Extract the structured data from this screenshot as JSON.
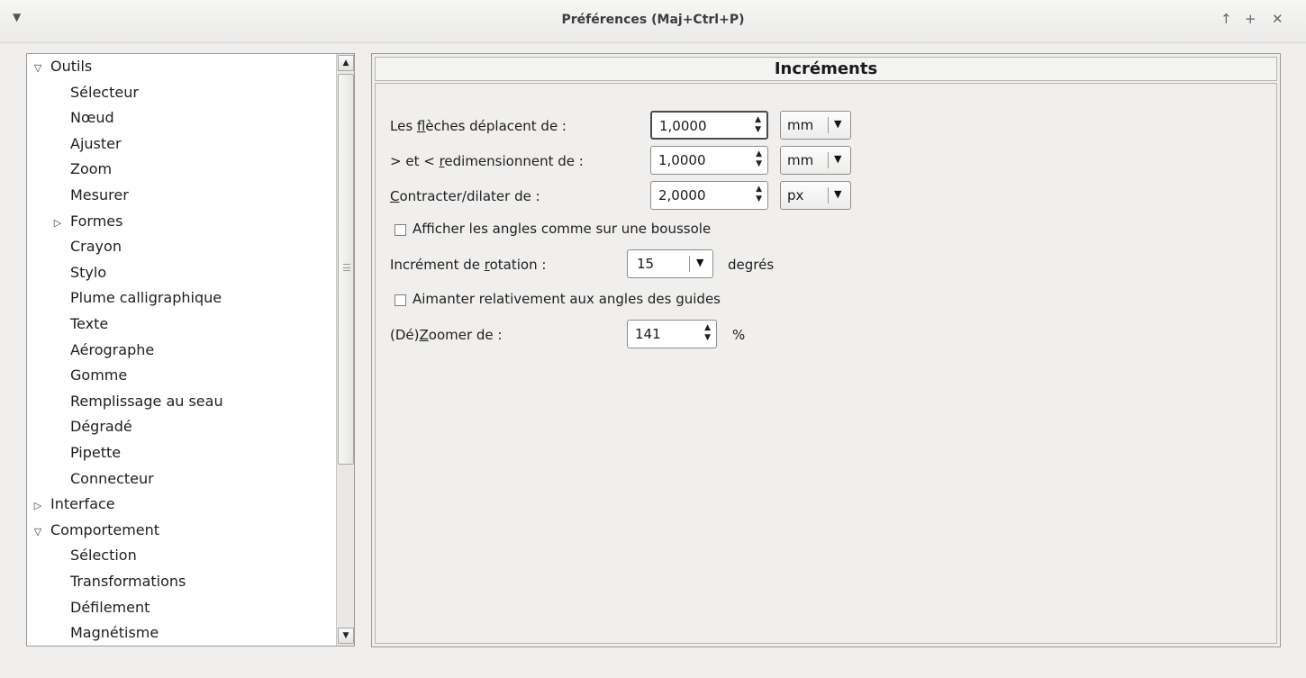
{
  "window": {
    "title": "Préférences (Maj+Ctrl+P)",
    "menu_icon": "chevron-down-icon",
    "controls": [
      "up-arrow-icon",
      "plus-icon",
      "close-icon"
    ]
  },
  "tree": {
    "items": [
      {
        "label": "Outils",
        "level": 0,
        "expander": "expanded"
      },
      {
        "label": "Sélecteur",
        "level": 1
      },
      {
        "label": "Nœud",
        "level": 1
      },
      {
        "label": "Ajuster",
        "level": 1
      },
      {
        "label": "Zoom",
        "level": 1
      },
      {
        "label": "Mesurer",
        "level": 1
      },
      {
        "label": "Formes",
        "level": 1,
        "expander": "collapsed"
      },
      {
        "label": "Crayon",
        "level": 1
      },
      {
        "label": "Stylo",
        "level": 1
      },
      {
        "label": "Plume calligraphique",
        "level": 1
      },
      {
        "label": "Texte",
        "level": 1
      },
      {
        "label": "Aérographe",
        "level": 1
      },
      {
        "label": "Gomme",
        "level": 1
      },
      {
        "label": "Remplissage au seau",
        "level": 1
      },
      {
        "label": "Dégradé",
        "level": 1
      },
      {
        "label": "Pipette",
        "level": 1
      },
      {
        "label": "Connecteur",
        "level": 1
      },
      {
        "label": "Interface",
        "level": 0,
        "expander": "collapsed"
      },
      {
        "label": "Comportement",
        "level": 0,
        "expander": "expanded"
      },
      {
        "label": "Sélection",
        "level": 1
      },
      {
        "label": "Transformations",
        "level": 1
      },
      {
        "label": "Défilement",
        "level": 1
      },
      {
        "label": "Magnétisme",
        "level": 1
      }
    ]
  },
  "panel": {
    "title": "Incréments",
    "arrow_keys": {
      "label_pre": "Les ",
      "label_mnemonic": "f",
      "label_post": "lèches déplacent de :",
      "value": "1,0000",
      "unit": "mm"
    },
    "scale": {
      "label_pre": "> et < ",
      "label_mnemonic": "r",
      "label_post": "edimensionnent de :",
      "value": "1,0000",
      "unit": "mm"
    },
    "inset": {
      "label_pre": "",
      "label_mnemonic": "C",
      "label_post": "ontracter/dilater de :",
      "value": "2,0000",
      "unit": "px"
    },
    "compass": {
      "label": "Afficher les angles comme sur une boussole",
      "checked": false
    },
    "rotation": {
      "label_pre": "Incrément de ",
      "label_mnemonic": "r",
      "label_post": "otation :",
      "value": "15",
      "unit": "degrés"
    },
    "guides": {
      "label": "Aimanter relativement aux angles des guides",
      "checked": false
    },
    "zoom": {
      "label_pre": "(Dé)",
      "label_mnemonic": "Z",
      "label_post": "oomer de :",
      "value": "141",
      "unit": "%"
    }
  }
}
